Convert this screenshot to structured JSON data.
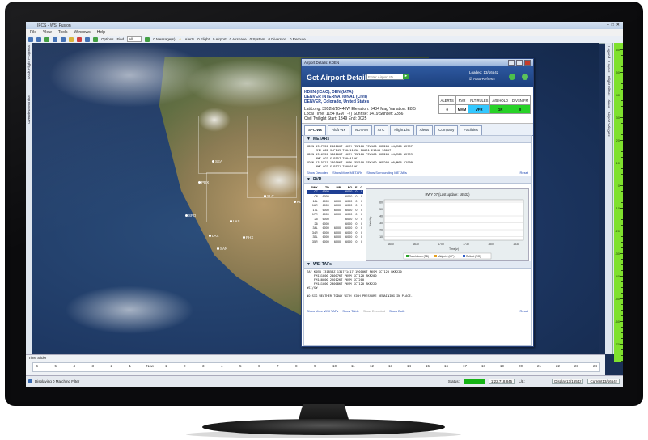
{
  "app": {
    "title": "IFCS - WSI Fusion",
    "menu": [
      "File",
      "View",
      "Tools",
      "Windows",
      "Help"
    ],
    "toolbar": {
      "options_label": "Options",
      "find_label": "Find",
      "find_value": "All",
      "messages": "0 Message(s)",
      "alerts": "Alerts",
      "flight": "0 Flight",
      "airport": "0 Airport",
      "airspace": "0 Airspace",
      "system": "0 System",
      "diversion": "0 Diversion",
      "reroute": "0 Reroute"
    },
    "left_tabs": [
      "Dock Flight Progress",
      "Overview Monitor"
    ],
    "right_tabs": [
      "Legend",
      "Layers",
      "Flight Filters",
      "Views",
      "Airport Widgets"
    ],
    "ruler_labels": [
      "60",
      "50",
      "40",
      "30",
      "20",
      "10",
      "0",
      "-10",
      "-20",
      "-30",
      "-40",
      "-50",
      "-60",
      "-70"
    ]
  },
  "map": {
    "cities": [
      {
        "name": "SEA"
      },
      {
        "name": "PDX"
      },
      {
        "name": "SLC"
      },
      {
        "name": "KDEN"
      },
      {
        "name": "SFO"
      },
      {
        "name": "LAS"
      },
      {
        "name": "LAX"
      },
      {
        "name": "PHX"
      },
      {
        "name": "SAN"
      }
    ]
  },
  "time_slider": {
    "label": "Time Slider",
    "ticks": [
      "-6",
      "-5",
      "-4",
      "-3",
      "-2",
      "-1",
      "Now",
      "1",
      "2",
      "3",
      "4",
      "5",
      "6",
      "7",
      "8",
      "9",
      "10",
      "11",
      "12",
      "13",
      "14",
      "15",
      "16",
      "17",
      "18",
      "19",
      "20",
      "21",
      "22",
      "23",
      "24"
    ]
  },
  "status": {
    "filter": "Displaying 0 Matching Filter",
    "status_label": "Status:",
    "coords": "1:22,718,845",
    "lat_lon": "L/L:",
    "display": "Display13/1654z",
    "current": "Current13/1654z"
  },
  "dialog": {
    "window_title": "Airport Details: KDEN",
    "header": {
      "title": "Get Airport Details:",
      "input_placeholder": "Enter Airport ID",
      "go": "▸",
      "loaded": "Loaded: 13/1654z",
      "auto_refresh": "Auto-Refresh"
    },
    "airport": {
      "ids": "KDEN (ICAO), DEN (IATA)",
      "name": "DENVER INTERNATIONAL (Civil)",
      "location": "DENVER, Colorado, United States",
      "latlong": "Lat/Long: 3952N/10440W  Elevation: 5434  Mag Variation: E8.5",
      "localtime": "Local Time: 1154 (GMT -7)  Sunrise: 1419  Sunset: 2356",
      "twilight": "Civil Twilight Start: 1349  End: 0025"
    },
    "flags": {
      "headers": [
        "ALERTS",
        "RVR",
        "FLT RULES",
        "A/B HOLD",
        "DIVSN FM"
      ],
      "values": [
        "0",
        "MMM",
        "VFR",
        "GR",
        "0"
      ],
      "colors": [
        "#ffffff",
        "#ffffff",
        "#32c8ff",
        "#28d228",
        "#28d228"
      ]
    },
    "tabs": [
      "SFC Wx",
      "Aloft Wx",
      "NOTAM",
      "ATC",
      "Flight List",
      "Alerts",
      "Company",
      "Facilities"
    ],
    "metars": {
      "title": "METARs",
      "lines": [
        "KDEN 131752Z 20010KT 10SM FEW100 FEW160 BKN200 04/M06 A2997",
        "     RMK AO2 SLP149 T00411056 10061 21044 58007",
        "KDEN 131652Z 18010KT 10SM FEW100 FEW160 BKN200 04/M06 A2999",
        "     RMK AO2 SLP157 T00441061",
        "KDEN 131552Z 18010KT 10SM FEW100 FEW160 BKN200 00/M06 A2999",
        "     RMK AO2 SLP171 T00001061"
      ],
      "links": [
        "Show Decoded",
        "Show More METARs",
        "Show Surrounding METARs"
      ],
      "reset": "Reset"
    },
    "rvr": {
      "title": "RVR",
      "columns": [
        "RWY",
        "TD",
        "MP",
        "RO",
        "E",
        "C"
      ],
      "rows": [
        [
          "07",
          "6000",
          "",
          "6000",
          "0",
          "0"
        ],
        [
          "08",
          "6000",
          "",
          "6000",
          "0",
          "0"
        ],
        [
          "16L",
          "6000",
          "6000",
          "6000",
          "0",
          "0"
        ],
        [
          "16R",
          "6000",
          "6000",
          "6000",
          "0",
          "0"
        ],
        [
          "17L",
          "6000",
          "6000",
          "6000",
          "0",
          "0"
        ],
        [
          "17R",
          "6000",
          "6000",
          "6000",
          "0",
          "0"
        ],
        [
          "25",
          "6000",
          "",
          "6000",
          "0",
          "0"
        ],
        [
          "26",
          "6000",
          "",
          "6000",
          "0",
          "0"
        ],
        [
          "34L",
          "6000",
          "6000",
          "6000",
          "0",
          "0"
        ],
        [
          "34R",
          "6000",
          "6000",
          "6000",
          "0",
          "0"
        ],
        [
          "35L",
          "6000",
          "6000",
          "6000",
          "0",
          "0"
        ],
        [
          "35R",
          "6000",
          "6000",
          "6000",
          "0",
          "0"
        ]
      ],
      "chart_title": "RWY 07 (Last update: 1653z)",
      "y_label": "Visibility",
      "x_label": "Time(z)",
      "x_ticks": [
        "1600",
        "1630",
        "1700",
        "1730",
        "1800",
        "1830"
      ],
      "y_ticks": [
        "60",
        "50",
        "40",
        "30",
        "20",
        "10"
      ],
      "legend": [
        "Touchdown (TD)",
        "Midpoint (MP)",
        "Rollout (RO)"
      ],
      "legend_colors": [
        "#2aa52a",
        "#e4a020",
        "#2c5cc8"
      ]
    },
    "tafs": {
      "title": "WSI TAFs",
      "lines": [
        "TAF KDEN 131858Z 1317/1417 19010KT P6SM SCT120 BKN220",
        "    FM131800 24007KT P6SM SCT120 BKN200",
        "    FM140000 22012KT P6SM SCT200",
        "    FM141000 23008KT P6SM SCT120 BKN220",
        "WSI/SW",
        "",
        "NO SIG WEATHER TODAY WITH HIGH PRESSURE REMAINING IN PLACE."
      ],
      "links": [
        "Show More WSI TAFs",
        "Show Table",
        "Show Decoded",
        "Show Both"
      ],
      "reset": "Reset"
    }
  }
}
